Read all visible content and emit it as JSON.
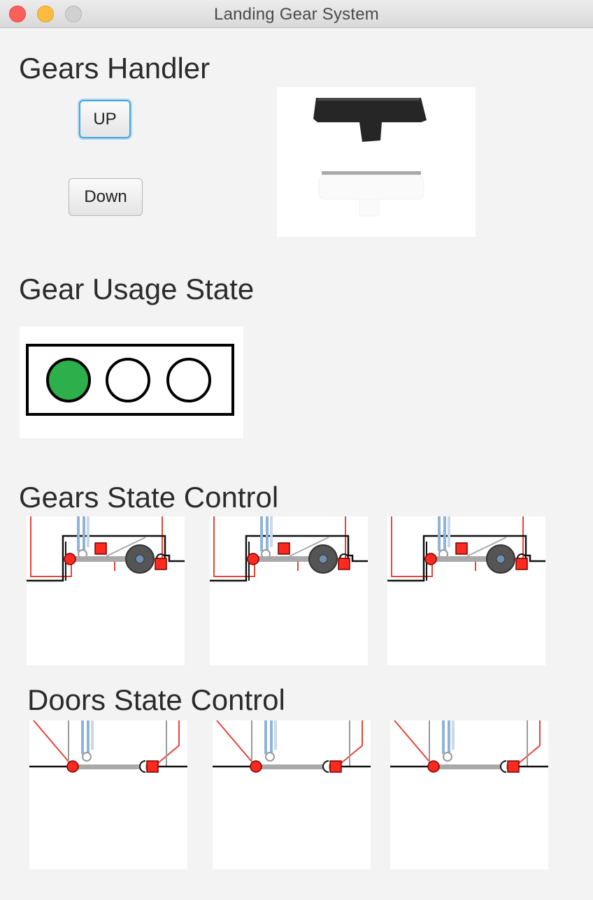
{
  "window": {
    "title": "Landing Gear System"
  },
  "gears_handler": {
    "title": "Gears Handler",
    "up_label": "UP",
    "down_label": "Down",
    "focused_button": "UP"
  },
  "gear_usage_state": {
    "title": "Gear Usage State",
    "lights": [
      "green",
      "off",
      "off"
    ],
    "colors": {
      "active": "#2db04b",
      "off": "#ffffff"
    }
  },
  "gears_state_control": {
    "title": "Gears State Control",
    "panels": [
      "gear-1",
      "gear-2",
      "gear-3"
    ]
  },
  "doors_state_control": {
    "title": "Doors State Control",
    "panels": [
      "door-1",
      "door-2",
      "door-3"
    ]
  },
  "colors": {
    "window_bg": "#f3f3f3",
    "hydraulic_line": "#e8443a",
    "actuator_blue": "#8fb3d9",
    "lock_red": "#ff2a1f"
  }
}
